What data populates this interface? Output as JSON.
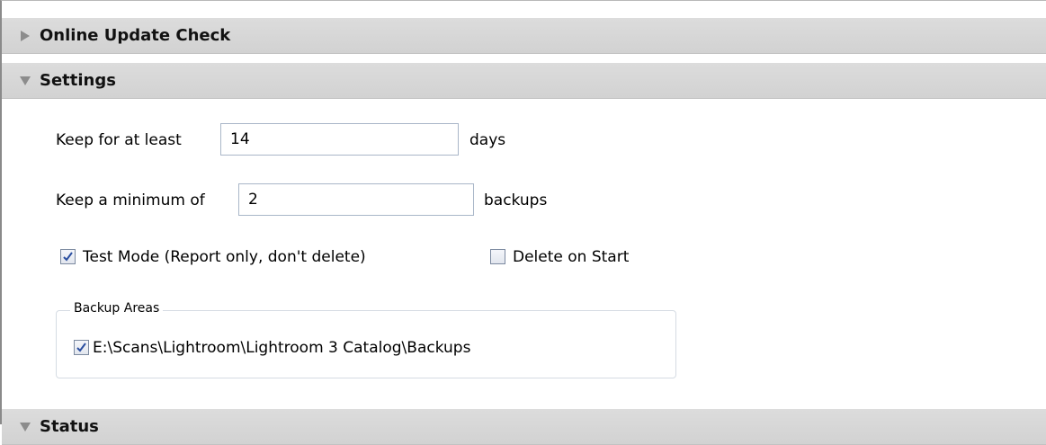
{
  "sections": {
    "online_update": {
      "title": "Online Update Check"
    },
    "settings": {
      "title": "Settings"
    },
    "status": {
      "title": "Status"
    }
  },
  "settings": {
    "keep_days_label": "Keep for at least",
    "keep_days_value": "14",
    "keep_days_unit": "days",
    "keep_min_label": "Keep a minimum of",
    "keep_min_value": "2",
    "keep_min_unit": "backups",
    "test_mode_label": "Test Mode (Report only, don't delete)",
    "test_mode_checked": true,
    "delete_on_start_label": "Delete on Start",
    "delete_on_start_checked": false
  },
  "backup_areas": {
    "legend": "Backup Areas",
    "items": [
      {
        "path": "E:\\Scans\\Lightroom\\Lightroom 3 Catalog\\Backups",
        "checked": true
      }
    ]
  },
  "colors": {
    "header_bg": "#d6d6d6",
    "check_mark": "#2a4ea0"
  }
}
